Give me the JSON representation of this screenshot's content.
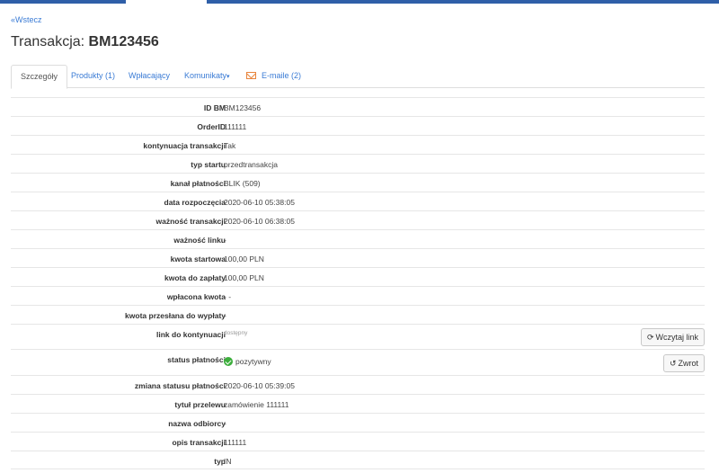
{
  "nav": {
    "back_label": "«Wstecz"
  },
  "title": {
    "prefix": "Transakcja: ",
    "id": "BM123456"
  },
  "tabs": [
    {
      "label": "Szczegóły",
      "active": true
    },
    {
      "label": "Produkty (1)"
    },
    {
      "label": "Wpłacający"
    },
    {
      "label": "Komunikaty",
      "caret": "▾"
    },
    {
      "label": "E-maile (2)",
      "icon": "mail-icon"
    }
  ],
  "details": [
    {
      "label": "ID BM",
      "value": "BM123456"
    },
    {
      "label": "OrderID",
      "value": "111111"
    },
    {
      "label": "kontynuacja transakcji",
      "value": "Tak"
    },
    {
      "label": "typ startu",
      "value": "przedtransakcja"
    },
    {
      "label": "kanał płatności",
      "value": "BLIK (509)"
    },
    {
      "label": "data rozpoczęcia",
      "value": "2020-06-10 05:38:05"
    },
    {
      "label": "ważność transakcji",
      "value": "2020-06-10 06:38:05"
    },
    {
      "label": "ważność linku",
      "value": "-"
    },
    {
      "label": "kwota startowa",
      "value": "100,00 PLN"
    },
    {
      "label": "kwota do zapłaty",
      "value": "100,00 PLN"
    },
    {
      "label": "wpłacona kwota",
      "value": "- -"
    },
    {
      "label": "kwota przesłana do wypłaty",
      "value": "-"
    },
    {
      "label": "link do kontynuacji",
      "value": "dostępny",
      "button": {
        "label": "Wczytaj link",
        "icon": "refresh-icon",
        "glyph": "⟳"
      }
    },
    {
      "label": "status płatności",
      "value": "pozytywny",
      "status_icon": "check-circle-icon",
      "status_color": "#3cae3c",
      "button": {
        "label": "Zwrot",
        "icon": "undo-icon",
        "glyph": "↺"
      }
    },
    {
      "label": "zmiana statusu płatności",
      "value": "2020-06-10 05:39:05"
    },
    {
      "label": "tytuł przelewu",
      "value": "zamówienie 111111"
    },
    {
      "label": "nazwa odbiorcy",
      "value": "-"
    },
    {
      "label": "opis transakcji",
      "value": "111111"
    },
    {
      "label": "typ",
      "value": "IN"
    }
  ],
  "colors": {
    "link": "#3a7bd5",
    "topbar": "#2f5fa8",
    "mail_icon": "#e8843c"
  }
}
